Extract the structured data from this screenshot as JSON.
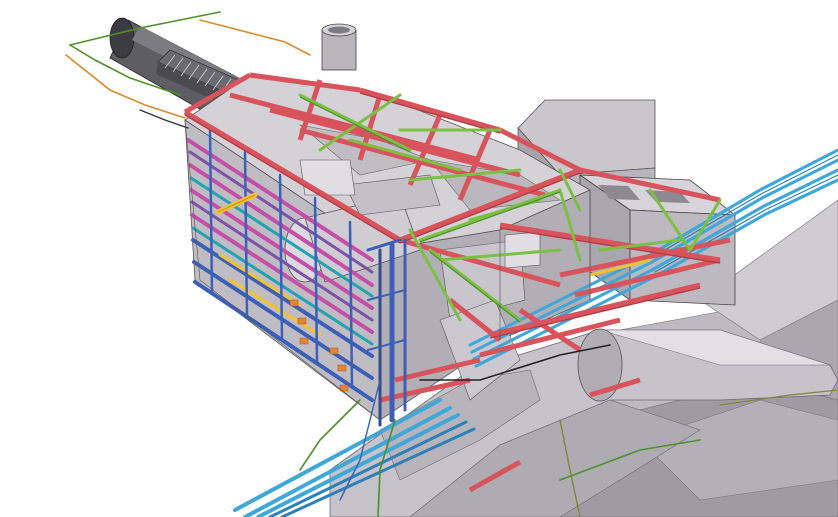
{
  "scene": {
    "kind": "3d-bim-steel-structure-render",
    "background": "#ffffff",
    "colors": {
      "steel_beam_red": "#d9535d",
      "steel_beam_red_dark": "#b33c47",
      "brace_green": "#7bc043",
      "brace_green_dark": "#4f8f2a",
      "column_blue": "#3c5fb8",
      "column_magenta": "#c44fa8",
      "column_purple": "#7d52a8",
      "pipe_cyan": "#3fa8d9",
      "pipe_yellow": "#f2c230",
      "cable_olive": "#7a8a3a",
      "cable_orange": "#d98a2e",
      "concrete_grey": "#b8b6bc",
      "concrete_light": "#d6d4d9",
      "concrete_dark": "#8c8a90",
      "tunnel_grey": "#a9a7ad",
      "outline_black": "#222222"
    }
  }
}
